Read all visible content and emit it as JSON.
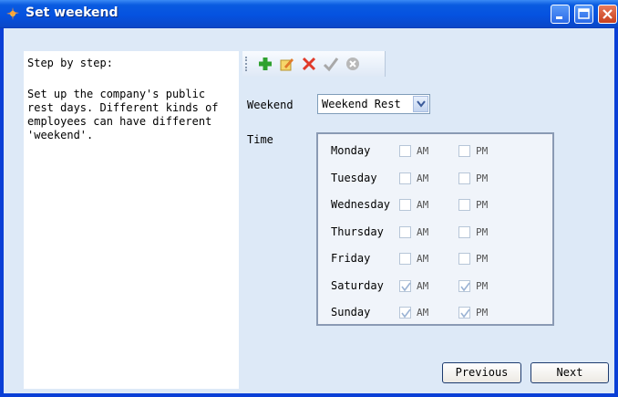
{
  "window": {
    "title": "Set weekend"
  },
  "help": {
    "heading": "Step by step:",
    "text": "Set up the company's public rest days. Different kinds of employees can have different 'weekend'."
  },
  "toolbar": {
    "items": [
      "add-icon",
      "edit-icon",
      "delete-icon",
      "confirm-icon",
      "cancel-icon"
    ]
  },
  "form": {
    "weekend_label": "Weekend",
    "weekend_value": "Weekend Rest",
    "time_label": "Time"
  },
  "days": [
    {
      "name": "Monday",
      "am": false,
      "pm": false
    },
    {
      "name": "Tuesday",
      "am": false,
      "pm": false
    },
    {
      "name": "Wednesday",
      "am": false,
      "pm": false
    },
    {
      "name": "Thursday",
      "am": false,
      "pm": false
    },
    {
      "name": "Friday",
      "am": false,
      "pm": false
    },
    {
      "name": "Saturday",
      "am": true,
      "pm": true
    },
    {
      "name": "Sunday",
      "am": true,
      "pm": true
    }
  ],
  "am_label": "AM",
  "pm_label": "PM",
  "buttons": {
    "previous": "Previous",
    "next": "Next"
  }
}
